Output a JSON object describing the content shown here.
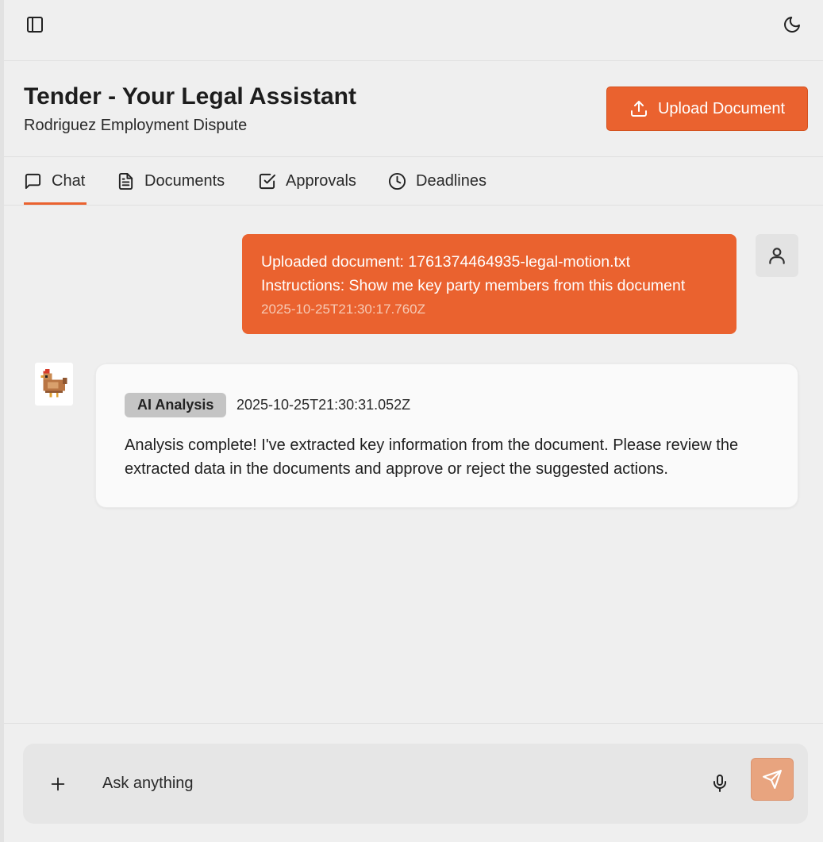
{
  "topbar": {
    "sidebar_toggle_icon": "sidebar-panel-icon",
    "theme_toggle_icon": "moon-icon"
  },
  "header": {
    "title": "Tender - Your Legal Assistant",
    "subtitle": "Rodriguez Employment Dispute",
    "upload_label": "Upload Document",
    "upload_icon": "upload-icon"
  },
  "tabs": [
    {
      "label": "Chat",
      "icon": "chat-bubble-icon",
      "active": true
    },
    {
      "label": "Documents",
      "icon": "document-icon",
      "active": false
    },
    {
      "label": "Approvals",
      "icon": "checkbox-icon",
      "active": false
    },
    {
      "label": "Deadlines",
      "icon": "clock-icon",
      "active": false
    }
  ],
  "messages": {
    "user": {
      "line1": "Uploaded document: 1761374464935-legal-motion.txt",
      "line2": "Instructions: Show me key party members from this document",
      "timestamp": "2025-10-25T21:30:17.760Z",
      "avatar_icon": "user-icon"
    },
    "assistant": {
      "avatar_icon": "chicken-avatar-icon",
      "badge": "AI Analysis",
      "timestamp": "2025-10-25T21:30:31.052Z",
      "text": "Analysis complete! I've extracted key information from the document. Please review the extracted data in the documents and approve or reject the suggested actions."
    }
  },
  "composer": {
    "placeholder": "Ask anything",
    "value": "",
    "plus_icon": "plus-icon",
    "mic_icon": "microphone-icon",
    "send_icon": "send-icon"
  },
  "colors": {
    "accent": "#ea622f",
    "send_disabled": "#e8a47f",
    "background": "#efefef"
  }
}
